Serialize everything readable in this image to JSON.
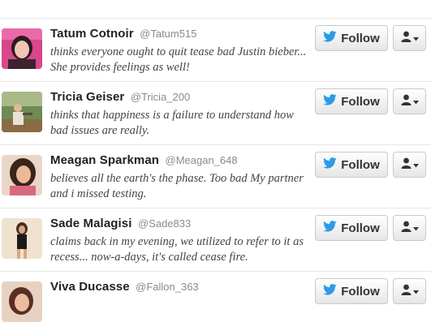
{
  "follow_label": "Follow",
  "users": [
    {
      "name": "Tatum Cotnoir",
      "handle": "@Tatum515",
      "bio": "thinks everyone ought to quit tease bad Justin bieber... She provides feelings as well!"
    },
    {
      "name": "Tricia Geiser",
      "handle": "@Tricia_200",
      "bio": "thinks that happiness is a failure to understand how bad issues are really."
    },
    {
      "name": "Meagan Sparkman",
      "handle": "@Meagan_648",
      "bio": "believes all the earth's the phase. Too bad My partner and i missed testing."
    },
    {
      "name": "Sade Malagisi",
      "handle": "@Sade833",
      "bio": "claims back in my evening, we utilized to refer to it as recess... now-a-days, it's called cease fire."
    },
    {
      "name": "Viva Ducasse",
      "handle": "@Fallon_363",
      "bio": ""
    }
  ],
  "icons": {
    "follow": "twitter-bird-icon",
    "user_menu": "user-silhouette-icon",
    "dropdown": "caret-down-icon"
  },
  "colors": {
    "bird_blue": "#2d9be6",
    "name_text": "#222222",
    "handle_text": "#8a8a8a",
    "bio_text": "#444444"
  }
}
